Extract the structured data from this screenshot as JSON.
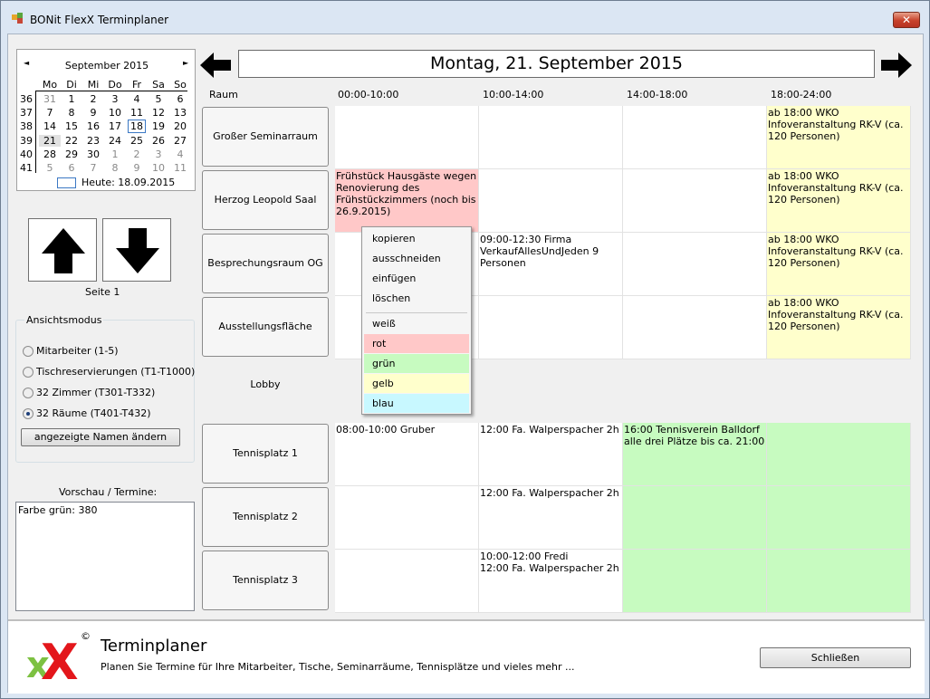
{
  "window": {
    "title": "BONit FlexX Terminplaner",
    "close_symbol": "✕"
  },
  "calendar": {
    "month": "September 2015",
    "prev": "◄",
    "next": "►",
    "weekdays": [
      "Mo",
      "Di",
      "Mi",
      "Do",
      "Fr",
      "Sa",
      "So"
    ],
    "weeks": [
      {
        "kw": "36",
        "days": [
          "31",
          "1",
          "2",
          "3",
          "4",
          "5",
          "6"
        ]
      },
      {
        "kw": "37",
        "days": [
          "7",
          "8",
          "9",
          "10",
          "11",
          "12",
          "13"
        ]
      },
      {
        "kw": "38",
        "days": [
          "14",
          "15",
          "16",
          "17",
          "18",
          "19",
          "20"
        ]
      },
      {
        "kw": "39",
        "days": [
          "21",
          "22",
          "23",
          "24",
          "25",
          "26",
          "27"
        ]
      },
      {
        "kw": "40",
        "days": [
          "28",
          "29",
          "30",
          "1",
          "2",
          "3",
          "4"
        ]
      },
      {
        "kw": "41",
        "days": [
          "5",
          "6",
          "7",
          "8",
          "9",
          "10",
          "11"
        ]
      }
    ],
    "today_label": "Heute: 18.09.2015"
  },
  "paging": {
    "up_icon": "arrow-up-icon",
    "down_icon": "arrow-down-icon",
    "page_label": "Seite 1"
  },
  "view_mode": {
    "legend": "Ansichtsmodus",
    "options": [
      {
        "label": "Mitarbeiter (1-5)",
        "selected": false
      },
      {
        "label": "Tischreservierungen (T1-T1000)",
        "selected": false
      },
      {
        "label": "32 Zimmer (T301-T332)",
        "selected": false
      },
      {
        "label": "32 Räume (T401-T432)",
        "selected": true
      }
    ],
    "rename_button": "angezeigte Namen ändern"
  },
  "preview": {
    "label": "Vorschau / Termine:",
    "text": "Farbe grün: 380"
  },
  "date_nav": {
    "date": "Montag, 21. September 2015"
  },
  "grid": {
    "room_header": "Raum",
    "columns": [
      "00:00-10:00",
      "10:00-14:00",
      "14:00-18:00",
      "18:00-24:00"
    ],
    "rooms_top": [
      {
        "name": "Großer Seminarraum",
        "cells": [
          {
            "text": "",
            "color": "white"
          },
          {
            "text": "",
            "color": "white"
          },
          {
            "text": "",
            "color": "white"
          },
          {
            "text": "ab 18:00 WKO Infoveranstaltung RK-V (ca. 120 Personen)",
            "color": "yellow"
          }
        ]
      },
      {
        "name": "Herzog Leopold Saal",
        "cells": [
          {
            "text": "Frühstück Hausgäste wegen Renovierung des Frühstückzimmers (noch bis 26.9.2015)",
            "color": "red"
          },
          {
            "text": "",
            "color": "white"
          },
          {
            "text": "",
            "color": "white"
          },
          {
            "text": "ab 18:00 WKO Infoveranstaltung RK-V (ca. 120 Personen)",
            "color": "yellow"
          }
        ]
      },
      {
        "name": "Besprechungsraum OG",
        "cells": [
          {
            "text": "",
            "color": "white"
          },
          {
            "text": "09:00-12:30 Firma VerkaufAllesUndJeden 9 Personen",
            "color": "white"
          },
          {
            "text": "",
            "color": "white"
          },
          {
            "text": "ab 18:00 WKO Infoveranstaltung RK-V (ca. 120 Personen)",
            "color": "yellow"
          }
        ]
      },
      {
        "name": "Ausstellungsfläche Lobby",
        "cells": [
          {
            "text": "",
            "color": "white"
          },
          {
            "text": "",
            "color": "white"
          },
          {
            "text": "",
            "color": "white"
          },
          {
            "text": "ab 18:00 WKO Infoveranstaltung RK-V (ca. 120 Personen)",
            "color": "yellow"
          }
        ]
      }
    ],
    "rooms_bottom": [
      {
        "name": "Tennisplatz 1",
        "cells": [
          {
            "text": "08:00-10:00 Gruber",
            "color": "white"
          },
          {
            "text": "12:00 Fa. Walperspacher 2h",
            "color": "white"
          },
          {
            "text": "16:00 Tennisverein Balldorf alle drei Plätze bis ca. 21:00",
            "color": "green"
          },
          {
            "text": "",
            "color": "green"
          }
        ]
      },
      {
        "name": "Tennisplatz 2",
        "cells": [
          {
            "text": "",
            "color": "white"
          },
          {
            "text": "12:00 Fa. Walperspacher 2h",
            "color": "white"
          },
          {
            "text": "",
            "color": "green"
          },
          {
            "text": "",
            "color": "green"
          }
        ]
      },
      {
        "name": "Tennisplatz 3",
        "cells": [
          {
            "text": "",
            "color": "white"
          },
          {
            "text": "10:00-12:00 Fredi\n12:00 Fa. Walperspacher 2h",
            "color": "white"
          },
          {
            "text": "",
            "color": "green"
          },
          {
            "text": "",
            "color": "green"
          }
        ]
      }
    ]
  },
  "context_menu": {
    "items": [
      {
        "label": "kopieren",
        "color": ""
      },
      {
        "label": "ausschneiden",
        "color": ""
      },
      {
        "label": "einfügen",
        "color": ""
      },
      {
        "label": "löschen",
        "color": ""
      },
      {
        "label": "weiß",
        "color": ""
      },
      {
        "label": "rot",
        "color": "#ffc8c8"
      },
      {
        "label": "grün",
        "color": "#c7fbc0"
      },
      {
        "label": "gelb",
        "color": "#ffffcc"
      },
      {
        "label": "blau",
        "color": "#c8f8ff"
      }
    ]
  },
  "footer": {
    "title": "Terminplaner",
    "subtitle": "Planen Sie Termine für Ihre Mitarbeiter, Tische, Seminarräume, Tennisplätze und vieles mehr ...",
    "close_button": "Schließen",
    "logo_icon": "flexx-logo-icon",
    "copyright": "©"
  },
  "colors": {
    "white": "#ffffff",
    "yellow": "#ffffcc",
    "red": "#ffc8c8",
    "green": "#c7fbc0",
    "blue": "#c8f8ff"
  }
}
